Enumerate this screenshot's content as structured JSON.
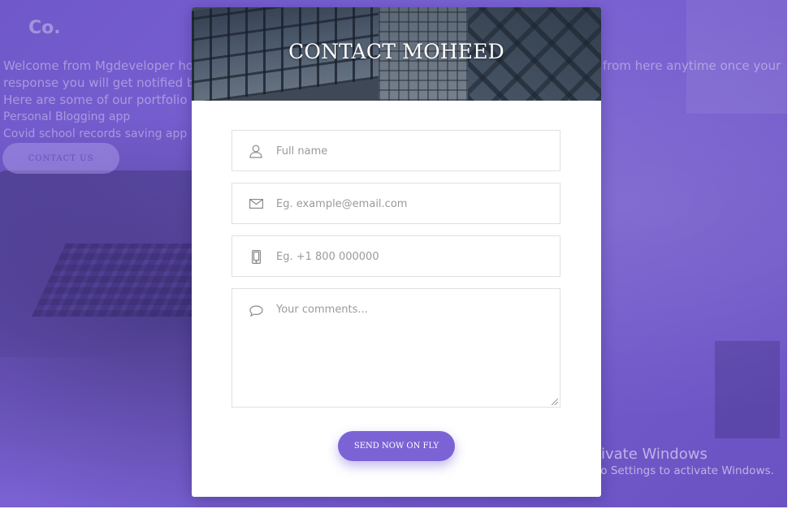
{
  "background": {
    "logo": "Co.",
    "welcome_line": "Welcome from Mgdeveloper ho",
    "welcome_line_right": "from here anytime once your",
    "response_line": "response you will get notified by",
    "portfolio_line": "Here are some of our portfolio p",
    "portfolio_items": [
      "Personal Blogging app",
      "Covid school records saving app"
    ],
    "contact_button": "CONTACT US"
  },
  "modal": {
    "title": "CONTACT MOHEED",
    "fields": {
      "name_placeholder": "Full name",
      "email_placeholder": "Eg. example@email.com",
      "phone_placeholder": "Eg. +1 800 000000",
      "comments_placeholder": "Your comments..."
    },
    "submit_label": "SEND NOW ON FLY"
  },
  "watermark": {
    "title": "Activate Windows",
    "subtitle": "Go to Settings to activate Windows."
  },
  "colors": {
    "accent": "#7b63d6",
    "background_overlay": "#6e55c4"
  },
  "icons": [
    "user-icon",
    "mail-icon",
    "phone-icon",
    "comment-icon"
  ]
}
